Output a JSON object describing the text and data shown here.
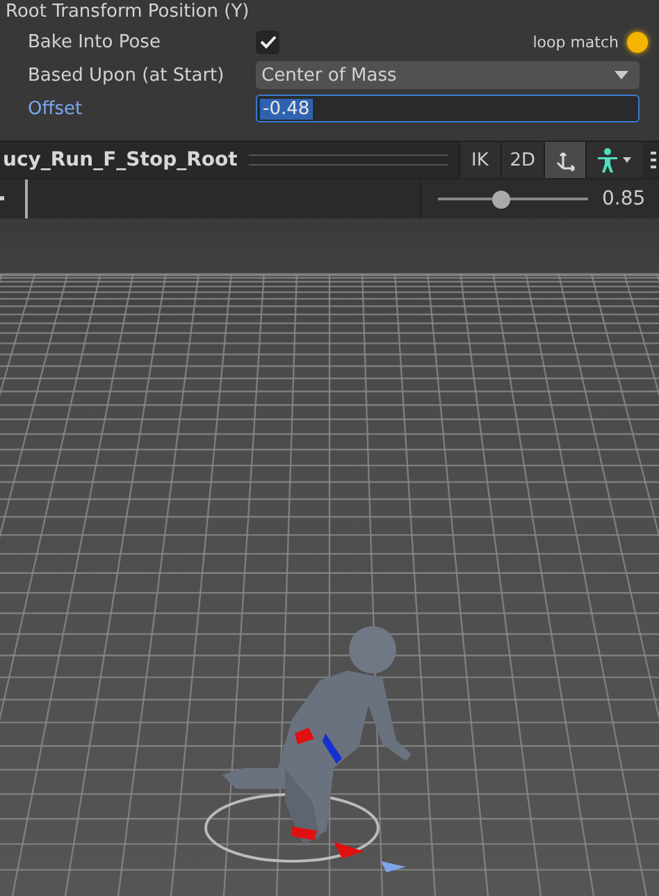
{
  "inspector": {
    "section_title": "Root Transform Position (Y)",
    "rows": [
      {
        "kind": "checkbox",
        "label": "Bake Into Pose",
        "checked": true,
        "focused": false
      },
      {
        "kind": "dropdown",
        "label": "Based Upon (at Start)",
        "value": "Center of Mass",
        "focused": false
      },
      {
        "kind": "number",
        "label": "Offset",
        "value": "-0.48",
        "focused": true,
        "text_selected": true
      }
    ],
    "loop_match": {
      "label": "loop match",
      "on": true
    }
  },
  "preview_toolbar": {
    "clip_name": "ucy_Run_F_Stop_Root",
    "tools": [
      {
        "kind": "text",
        "label": "IK",
        "selected": false
      },
      {
        "kind": "text",
        "label": "2D",
        "selected": false
      },
      {
        "kind": "pivot",
        "selected": true
      },
      {
        "kind": "avatar",
        "selected": false
      }
    ]
  },
  "timeline": {
    "speed_slider": {
      "level": 0.42
    },
    "speed": "0.85"
  }
}
